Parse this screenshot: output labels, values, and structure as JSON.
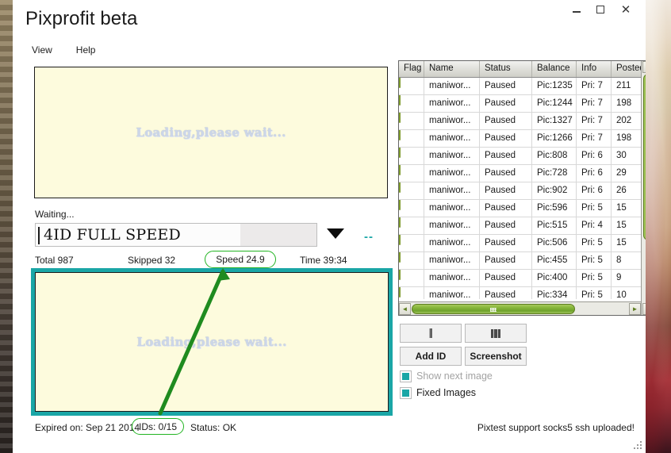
{
  "window": {
    "title": "Pixprofit beta",
    "minimize_label": "",
    "maximize_label": "",
    "close_label": "✕"
  },
  "menubar": {
    "items": [
      {
        "label": "View"
      },
      {
        "label": "Help"
      }
    ]
  },
  "preview_top": {
    "loading_text": "Loading,please wait..."
  },
  "preview_bottom": {
    "loading_text": "Loading,please wait..."
  },
  "progress": {
    "waiting_label": "Waiting...",
    "combo_value": "4ID FULL SPEED",
    "fill_percent": 73,
    "dashes": "--"
  },
  "stats": {
    "total": "Total 987",
    "skipped": "Skipped 32",
    "speed": "Speed 24.9",
    "time": "Time 39:34"
  },
  "table": {
    "columns": [
      "Flag",
      "Name",
      "Status",
      "Balance",
      "Info",
      "Posted"
    ],
    "rows": [
      {
        "flag": "flag-icon",
        "name": "maniwor...",
        "status": "Paused",
        "balance": "Pic:1235",
        "info": "Pri: 7",
        "posted": "211"
      },
      {
        "flag": "flag-icon",
        "name": "maniwor...",
        "status": "Paused",
        "balance": "Pic:1244",
        "info": "Pri: 7",
        "posted": "198"
      },
      {
        "flag": "flag-icon",
        "name": "maniwor...",
        "status": "Paused",
        "balance": "Pic:1327",
        "info": "Pri: 7",
        "posted": "202"
      },
      {
        "flag": "flag-icon",
        "name": "maniwor...",
        "status": "Paused",
        "balance": "Pic:1266",
        "info": "Pri: 7",
        "posted": "198"
      },
      {
        "flag": "flag-icon",
        "name": "maniwor...",
        "status": "Paused",
        "balance": "Pic:808",
        "info": "Pri: 6",
        "posted": "30"
      },
      {
        "flag": "flag-icon",
        "name": "maniwor...",
        "status": "Paused",
        "balance": "Pic:728",
        "info": "Pri: 6",
        "posted": "29"
      },
      {
        "flag": "flag-icon",
        "name": "maniwor...",
        "status": "Paused",
        "balance": "Pic:902",
        "info": "Pri: 6",
        "posted": "26"
      },
      {
        "flag": "flag-icon",
        "name": "maniwor...",
        "status": "Paused",
        "balance": "Pic:596",
        "info": "Pri: 5",
        "posted": "15"
      },
      {
        "flag": "flag-icon",
        "name": "maniwor...",
        "status": "Paused",
        "balance": "Pic:515",
        "info": "Pri: 4",
        "posted": "15"
      },
      {
        "flag": "flag-icon",
        "name": "maniwor...",
        "status": "Paused",
        "balance": "Pic:506",
        "info": "Pri: 5",
        "posted": "15"
      },
      {
        "flag": "flag-icon",
        "name": "maniwor...",
        "status": "Paused",
        "balance": "Pic:455",
        "info": "Pri: 5",
        "posted": "8"
      },
      {
        "flag": "flag-icon",
        "name": "maniwor...",
        "status": "Paused",
        "balance": "Pic:400",
        "info": "Pri: 5",
        "posted": "9"
      },
      {
        "flag": "flag-icon",
        "name": "maniwor...",
        "status": "Paused",
        "balance": "Pic:334",
        "info": "Pri: 5",
        "posted": "10"
      }
    ],
    "scroll": {
      "up_arrow": "▲",
      "down_arrow": "▼",
      "left_arrow": "◄",
      "right_arrow": "►"
    }
  },
  "controls": {
    "pause_label": "",
    "stop_label": "",
    "pause_icon": "pause-icon",
    "stop_icon": "stop-icon",
    "add_id_label": "Add ID",
    "screenshot_label": "Screenshot",
    "show_next_image_label": "Show next image",
    "fixed_images_label": "Fixed Images",
    "show_next_image_checked": true,
    "show_next_image_enabled": false,
    "fixed_images_checked": true
  },
  "status_bar": {
    "expired": "Expired on: Sep 21 2014",
    "ids": "IDs: 0/15",
    "status": "Status: OK",
    "support": "Pixtest support socks5  ssh uploaded!"
  },
  "annotation": {
    "line_color": "#1f8b1f",
    "highlight_color": "#22b422",
    "from_label": "IDs: 0/15",
    "to_label": "Speed 24.9"
  },
  "colors": {
    "accent_teal": "#1aa6a6",
    "annotation_green": "#1f8b1f",
    "preview_bg": "#fdfbdd",
    "scrollbar_green": "#87b63b"
  }
}
